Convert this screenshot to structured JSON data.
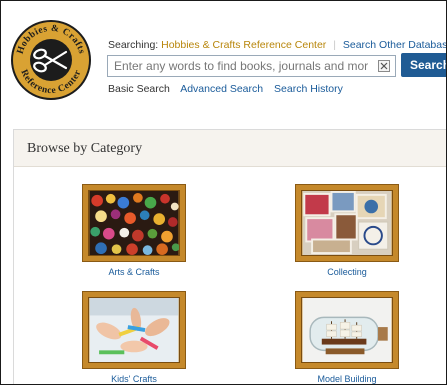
{
  "header": {
    "logo_text_top": "Hobbies & Crafts",
    "logo_text_bottom": "Reference Center"
  },
  "search": {
    "searching_label": "Searching:",
    "database_name": "Hobbies & Crafts Reference Center",
    "separator": "|",
    "other_databases": "Search Other Databases",
    "placeholder": "Enter any words to find books, journals and more",
    "value": "",
    "button_label": "Search"
  },
  "nav": {
    "basic_search": "Basic Search",
    "advanced_search": "Advanced Search",
    "search_history": "Search History"
  },
  "browse": {
    "title": "Browse by Category",
    "categories": [
      {
        "label": "Arts & Crafts",
        "icon": "beads-image"
      },
      {
        "label": "Collecting",
        "icon": "stamps-image"
      },
      {
        "label": "Kids' Crafts",
        "icon": "kids-hands-image"
      },
      {
        "label": "Model Building",
        "icon": "ship-in-bottle-image"
      }
    ]
  },
  "colors": {
    "accent_gold": "#c5892b",
    "link_blue": "#1a5b9a",
    "button_blue": "#1f5b94",
    "database_gold": "#b8860b"
  }
}
